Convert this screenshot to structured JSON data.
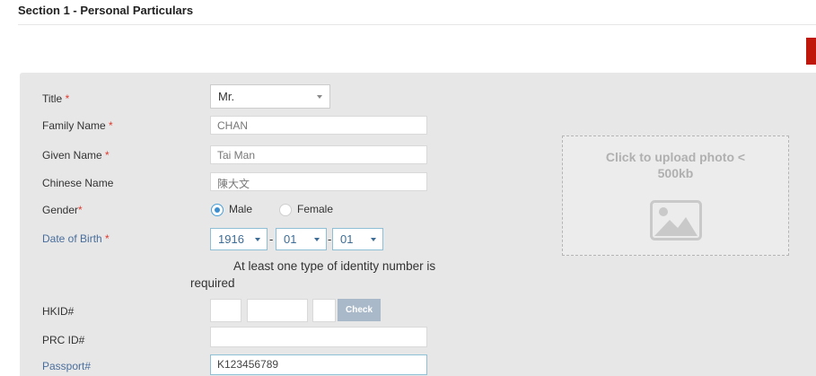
{
  "section": {
    "title": "Section 1 - Personal Particulars"
  },
  "colors": {
    "accent_red": "#c0170b",
    "panel": "#e7e7e7",
    "check_button": "#a9b9c9",
    "radio_selected": "#3b8fd0"
  },
  "form": {
    "title": {
      "label": "Title",
      "required": "*",
      "value": "Mr."
    },
    "family_name": {
      "label": "Family Name",
      "required": "*",
      "value": "CHAN"
    },
    "given_name": {
      "label": "Given Name",
      "required": "*",
      "value": "Tai Man"
    },
    "chinese_name": {
      "label": "Chinese Name",
      "value": "陳大文"
    },
    "gender": {
      "label": "Gender",
      "required": "*",
      "options": [
        "Male",
        "Female"
      ],
      "selected": "Male"
    },
    "dob": {
      "label": "Date of Birth",
      "required": "*",
      "year": "1916",
      "month": "01",
      "day": "01",
      "separator": "-"
    },
    "identity_note_line1": "At least one type of identity number is",
    "identity_note_line2": "required",
    "hkid": {
      "label": "HKID#",
      "part1": "",
      "part2": "",
      "check_digit": "",
      "check_label": "Check"
    },
    "prc_id": {
      "label": "PRC ID#",
      "value": ""
    },
    "passport": {
      "label": "Passport#",
      "value": "K123456789"
    }
  },
  "photo": {
    "text": "Click to upload photo < 500kb",
    "icon": "image-icon"
  }
}
